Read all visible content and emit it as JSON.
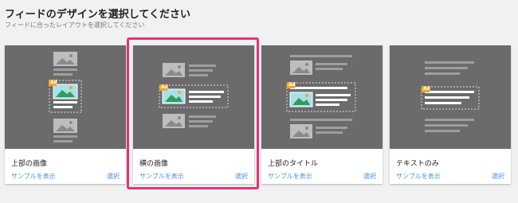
{
  "page": {
    "title": "フィードのデザインを選択してください",
    "subtitle": "フィードに合ったレイアウトを選択してください"
  },
  "cards": [
    {
      "name": "上部の画像",
      "sample_label": "サンプルを表示",
      "select_label": "選択",
      "ad_badge": "Ad",
      "highlighted": false
    },
    {
      "name": "横の画像",
      "sample_label": "サンプルを表示",
      "select_label": "選択",
      "ad_badge": "Ad",
      "highlighted": true
    },
    {
      "name": "上部のタイトル",
      "sample_label": "サンプルを表示",
      "select_label": "選択",
      "ad_badge": "Ad",
      "highlighted": false
    },
    {
      "name": "テキストのみ",
      "sample_label": "サンプルを表示",
      "select_label": "選択",
      "ad_badge": "Ad",
      "highlighted": false
    }
  ],
  "colors": {
    "preview_bg": "#6b6b6b",
    "link": "#4a90e2",
    "highlight": "#e6317a",
    "ad_badge": "#f5a623"
  }
}
